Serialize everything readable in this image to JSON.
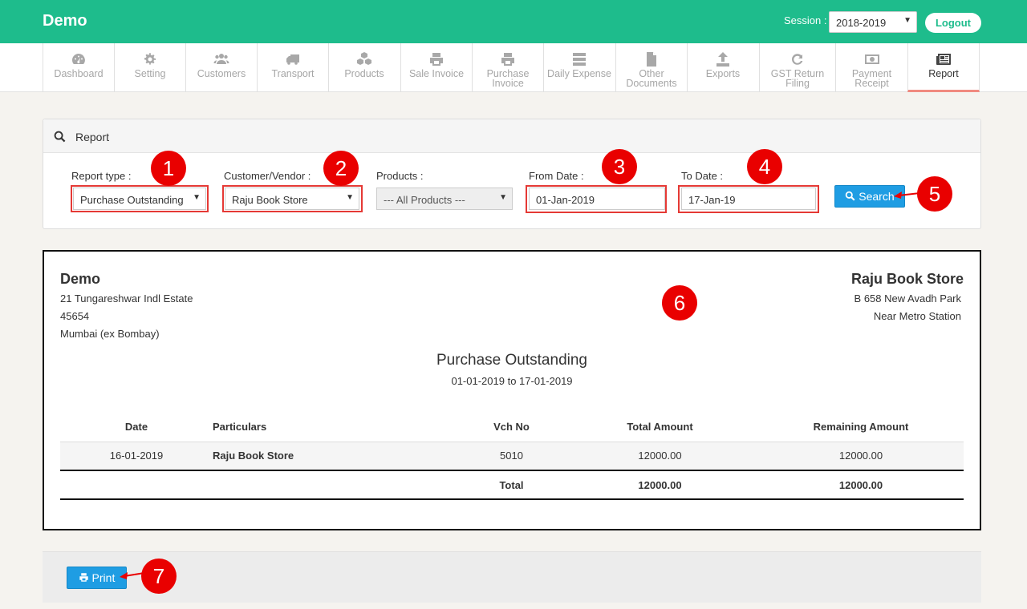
{
  "app": {
    "brand": "Demo"
  },
  "session": {
    "label": "Session :",
    "value": "2018-2019"
  },
  "logout_label": "Logout",
  "nav": [
    {
      "label": "Dashboard",
      "icon": "dashboard-icon"
    },
    {
      "label": "Setting",
      "icon": "gear-icon"
    },
    {
      "label": "Customers",
      "icon": "users-icon"
    },
    {
      "label": "Transport",
      "icon": "truck-icon"
    },
    {
      "label": "Products",
      "icon": "cubes-icon"
    },
    {
      "label": "Sale Invoice",
      "icon": "printer-icon"
    },
    {
      "label": "Purchase Invoice",
      "icon": "printer-icon"
    },
    {
      "label": "Daily Expense",
      "icon": "server-icon"
    },
    {
      "label": "Other Documents",
      "icon": "documents-icon"
    },
    {
      "label": "Exports",
      "icon": "upload-icon"
    },
    {
      "label": "GST Return Filing",
      "icon": "refresh-icon"
    },
    {
      "label": "Payment Receipt",
      "icon": "money-icon"
    },
    {
      "label": "Report",
      "icon": "newspaper-icon",
      "active": true
    }
  ],
  "panel": {
    "title": "Report"
  },
  "filters": {
    "report_type_label": "Report type :",
    "report_type_value": "Purchase Outstanding",
    "customer_label": "Customer/Vendor :",
    "customer_value": "Raju Book Store",
    "products_label": "Products :",
    "products_value": "--- All Products ---",
    "from_label": "From Date :",
    "from_value": "01-Jan-2019",
    "to_label": "To Date :",
    "to_value": "17-Jan-19",
    "search_label": "Search"
  },
  "badges": [
    "1",
    "2",
    "3",
    "4",
    "5",
    "6",
    "7"
  ],
  "report": {
    "company": {
      "name": "Demo",
      "line1": "21 Tungareshwar Indl Estate",
      "line2": "45654",
      "line3": "Mumbai (ex Bombay)"
    },
    "customer": {
      "name": "Raju Book Store",
      "line1": "B 658 New Avadh Park",
      "line2": "Near Metro Station"
    },
    "title": "Purchase Outstanding",
    "range": "01-01-2019 to 17-01-2019",
    "columns": [
      "Date",
      "Particulars",
      "Vch No",
      "Total Amount",
      "Remaining Amount"
    ],
    "rows": [
      {
        "date": "16-01-2019",
        "particulars": "Raju Book Store",
        "vch_no": "5010",
        "total": "12000.00",
        "remaining": "12000.00"
      }
    ],
    "totals": {
      "label": "Total",
      "total": "12000.00",
      "remaining": "12000.00"
    }
  },
  "print_label": "Print",
  "colors": {
    "topbar": "#1ebc8c",
    "button": "#1f9de3",
    "highlight": "#e53935",
    "badge": "#e90000"
  }
}
